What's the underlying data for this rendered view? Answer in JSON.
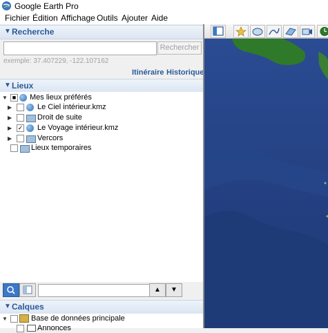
{
  "app": {
    "title": "Google Earth Pro"
  },
  "menu": [
    {
      "label": "Fichier"
    },
    {
      "label": "Édition"
    },
    {
      "label": "Affichage"
    },
    {
      "label": "Outils"
    },
    {
      "label": "Ajouter"
    },
    {
      "label": "Aide"
    }
  ],
  "search": {
    "header": "Recherche",
    "button": "Rechercher",
    "placeholder": "",
    "hint": "exemple: 37.407229, -122.107162",
    "itinerary": "Itinéraire",
    "history": "Historique"
  },
  "places": {
    "header": "Lieux",
    "items": [
      {
        "label": "Mes lieux préférés"
      },
      {
        "label": "Le Ciel intérieur.kmz"
      },
      {
        "label": "Droit de suite"
      },
      {
        "label": "Le Voyage intérieur.kmz"
      },
      {
        "label": "Vercors"
      },
      {
        "label": "Lieux temporaires"
      }
    ]
  },
  "layers": {
    "header": "Calques",
    "items": [
      {
        "label": "Base de données principale"
      },
      {
        "label": "Annonces"
      }
    ]
  },
  "colors": {
    "accent": "#2a5a9a",
    "map_ocean": "#2a4a8e",
    "land": "#2f7a2a"
  }
}
